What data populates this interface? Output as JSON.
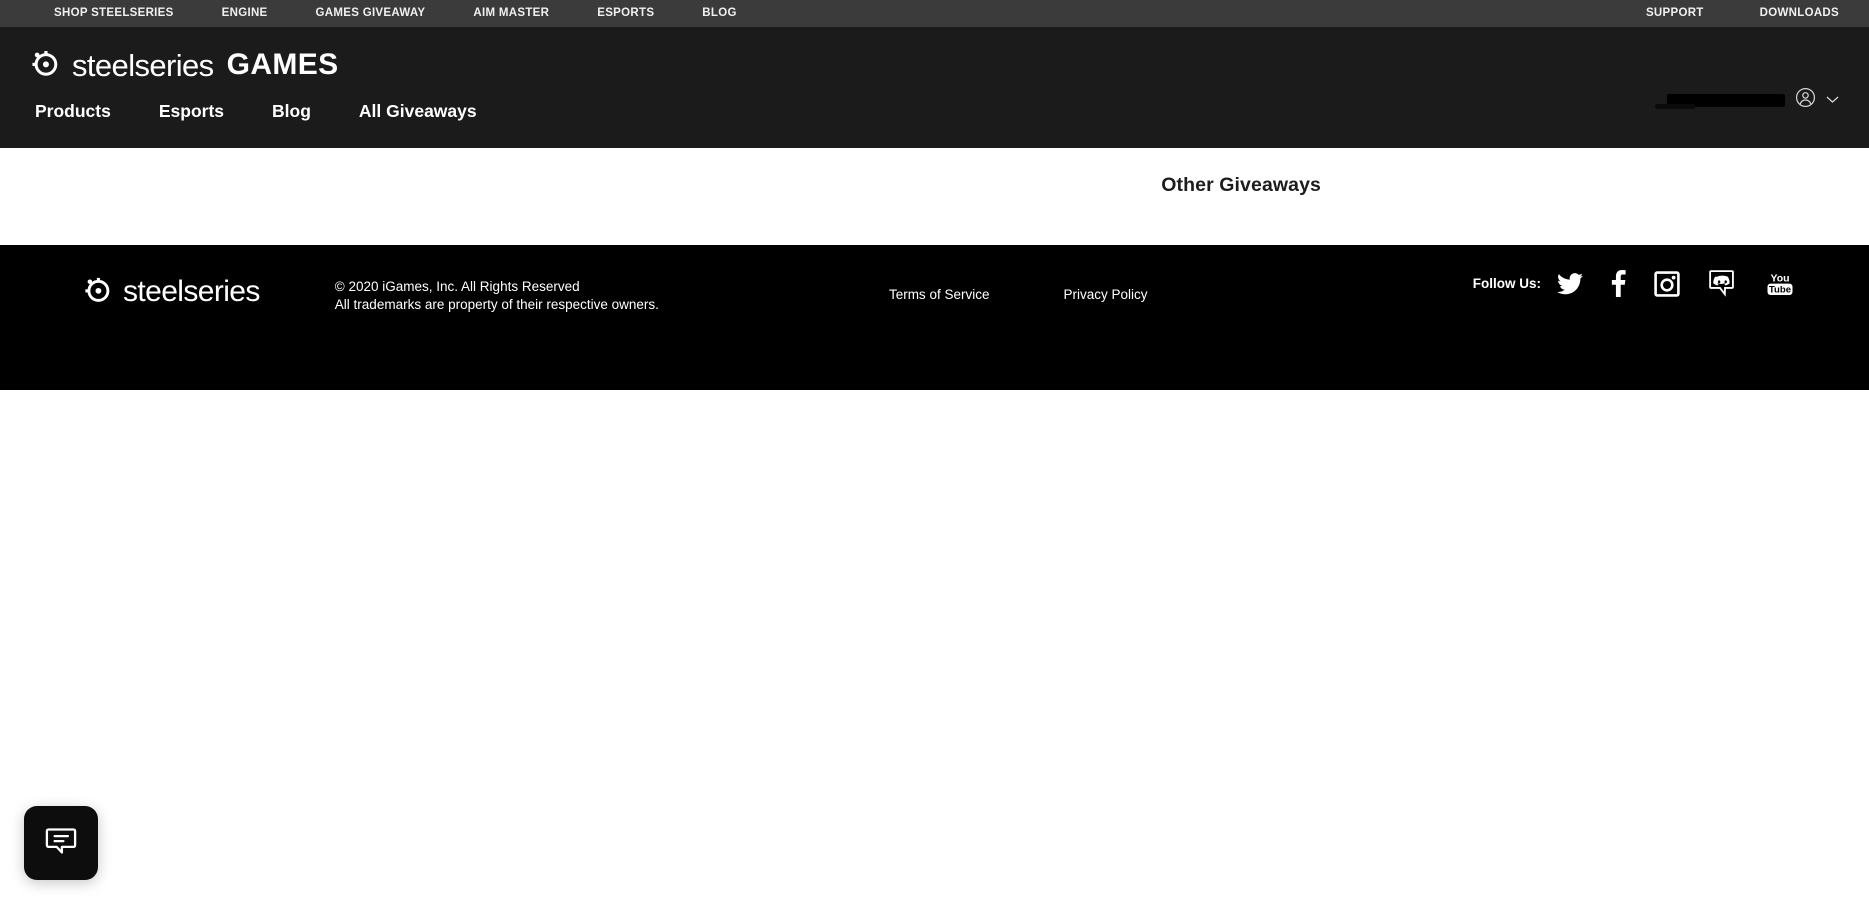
{
  "topbar": {
    "left_links": [
      {
        "label": "SHOP STEELSERIES",
        "name": "shop-steelseries"
      },
      {
        "label": "ENGINE",
        "name": "engine"
      },
      {
        "label": "GAMES GIVEAWAY",
        "name": "games-giveaway"
      },
      {
        "label": "AIM MASTER",
        "name": "aim-master"
      },
      {
        "label": "ESPORTS",
        "name": "esports"
      },
      {
        "label": "BLOG",
        "name": "blog"
      }
    ],
    "right_links": [
      {
        "label": "SUPPORT",
        "name": "support"
      },
      {
        "label": "DOWNLOADS",
        "name": "downloads"
      }
    ],
    "background": "#3b3b3b"
  },
  "header": {
    "brand_word": "steelseries",
    "brand_suffix": "GAMES",
    "logo_icon": "steelseries-logo-icon",
    "background": "#1b1b1b",
    "nav": [
      {
        "label": "Products",
        "name": "products"
      },
      {
        "label": "Esports",
        "name": "esports"
      },
      {
        "label": "Blog",
        "name": "blog"
      },
      {
        "label": "All Giveaways",
        "name": "all-giveaways"
      }
    ],
    "account": {
      "username": "",
      "avatar_icon": "user-circle-icon",
      "chevron_icon": "chevron-down-icon"
    }
  },
  "content": {
    "other_giveaways_title": "Other Giveaways",
    "background": "#ffffff"
  },
  "footer": {
    "logo_word": "steelseries",
    "logo_icon": "steelseries-logo-icon",
    "copyright_line1": "© 2020 iGames, Inc. All Rights Reserved",
    "copyright_line2": "All trademarks are property of their respective owners.",
    "links": [
      {
        "label": "Terms of Service",
        "name": "terms-of-service"
      },
      {
        "label": "Privacy Policy",
        "name": "privacy-policy"
      }
    ],
    "follow_label": "Follow Us:",
    "social": [
      {
        "name": "twitter-icon",
        "label": "Twitter"
      },
      {
        "name": "facebook-icon",
        "label": "Facebook"
      },
      {
        "name": "instagram-icon",
        "label": "Instagram"
      },
      {
        "name": "discord-icon",
        "label": "Discord"
      },
      {
        "name": "youtube-icon",
        "label": "YouTube"
      }
    ],
    "youtube_text_top": "You",
    "youtube_text_bottom": "Tube",
    "background": "#000000"
  },
  "chat_widget": {
    "icon": "chat-bubble-icon",
    "label": "Chat"
  }
}
